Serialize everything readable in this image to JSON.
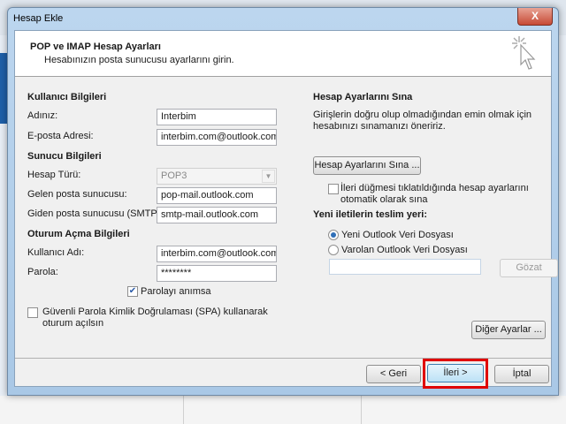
{
  "window": {
    "title": "Hesap Ekle",
    "close": "X"
  },
  "header": {
    "title": "POP ve IMAP Hesap Ayarları",
    "subtitle": "Hesabınızın posta sunucusu ayarlarını girin."
  },
  "user_info": {
    "heading": "Kullanıcı Bilgileri",
    "name_label": "Adınız:",
    "name_value": "Interbim",
    "email_label": "E-posta Adresi:",
    "email_value": "interbim.com@outlook.com"
  },
  "server_info": {
    "heading": "Sunucu Bilgileri",
    "type_label": "Hesap Türü:",
    "type_value": "POP3",
    "incoming_label": "Gelen posta sunucusu:",
    "incoming_value": "pop-mail.outlook.com",
    "outgoing_label": "Giden posta sunucusu (SMTP):",
    "outgoing_value": "smtp-mail.outlook.com"
  },
  "logon_info": {
    "heading": "Oturum Açma Bilgileri",
    "user_label": "Kullanıcı Adı:",
    "user_value": "interbim.com@outlook.com",
    "password_label": "Parola:",
    "password_value": "********",
    "remember_label": "Parolayı anımsa",
    "remember_checked": true,
    "spa_label_1": "Güvenli Parola Kimlik Doğrulaması (SPA) kullanarak",
    "spa_label_2": "oturum açılsın",
    "spa_checked": false
  },
  "test": {
    "heading": "Hesap Ayarlarını Sına",
    "desc_1": "Girişlerin doğru olup olmadığından emin olmak için",
    "desc_2": "hesabınızı sınamanızı öneririz.",
    "test_button": "Hesap Ayarlarını Sına ...",
    "auto_label_1": "İleri düğmesi tıklatıldığında hesap ayarlarını",
    "auto_label_2": "otomatik olarak sına",
    "auto_checked": false
  },
  "delivery": {
    "heading": "Yeni iletilerin teslim yeri:",
    "new_file": "Yeni Outlook Veri Dosyası",
    "existing_file": "Varolan Outlook Veri Dosyası",
    "selected": "new_file",
    "path_value": "",
    "browse": "Gözat"
  },
  "more_settings": "Diğer Ayarlar ...",
  "footer": {
    "back": "< Geri",
    "next": "İleri >",
    "cancel": "İptal",
    "highlight_color": "#e00000"
  }
}
